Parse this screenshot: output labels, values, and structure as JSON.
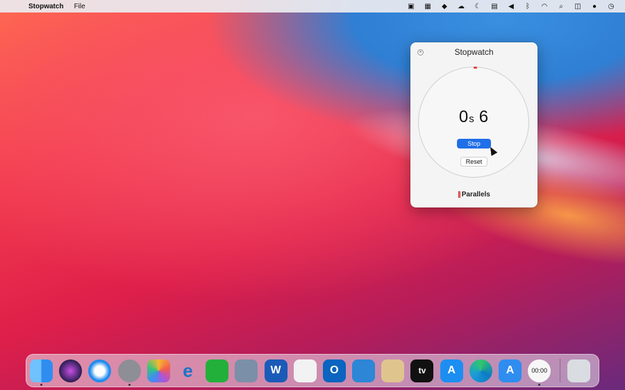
{
  "menubar": {
    "app_name": "Stopwatch",
    "menus": [
      "File"
    ],
    "status_icons": [
      "screen-record-icon",
      "photo-icon",
      "dropbox-icon",
      "cloud-icon",
      "moon-icon",
      "flag-us-icon",
      "volume-icon",
      "bluetooth-icon",
      "wifi-icon",
      "search-icon",
      "control-center-icon",
      "siri-icon",
      "clock-icon"
    ]
  },
  "window": {
    "title": "Stopwatch",
    "time_value_seconds": "0",
    "time_unit": "s",
    "time_value_tenths": "6",
    "stop_label": "Stop",
    "reset_label": "Reset",
    "brand": "Parallels",
    "brand_mark": "||"
  },
  "dock": {
    "items": [
      {
        "name": "finder",
        "label": "",
        "color": "#2f8df0"
      },
      {
        "name": "siri",
        "label": "",
        "color": "#2a1d52"
      },
      {
        "name": "safari",
        "label": "",
        "color": "#1e8bef"
      },
      {
        "name": "launchpad",
        "label": "",
        "color": "#8e8e96"
      },
      {
        "name": "photos",
        "label": "",
        "color": "#f4f4f4"
      },
      {
        "name": "internet-explorer",
        "label": "e",
        "color": "#1b74c9"
      },
      {
        "name": "parallels-green",
        "label": "",
        "color": "#22b03a"
      },
      {
        "name": "parallels-desktop",
        "label": "",
        "color": "#7c8fa8"
      },
      {
        "name": "word",
        "label": "W",
        "color": "#1b5bb8"
      },
      {
        "name": "pages",
        "label": "",
        "color": "#f2f2f2"
      },
      {
        "name": "outlook",
        "label": "O",
        "color": "#0a64c0"
      },
      {
        "name": "xcode",
        "label": "",
        "color": "#2d86d6"
      },
      {
        "name": "paint",
        "label": "",
        "color": "#e0c48e"
      },
      {
        "name": "apple-tv",
        "label": "tv",
        "color": "#111111"
      },
      {
        "name": "app-store",
        "label": "A",
        "color": "#1c8ef1"
      },
      {
        "name": "edge",
        "label": "",
        "color": "#0d7bc4"
      },
      {
        "name": "app-store-2",
        "label": "A",
        "color": "#2f8df0"
      },
      {
        "name": "stopwatch",
        "label": "00:00",
        "color": "#f7f7f7"
      },
      {
        "name": "trash",
        "label": "",
        "color": "#d9dde2"
      }
    ]
  }
}
